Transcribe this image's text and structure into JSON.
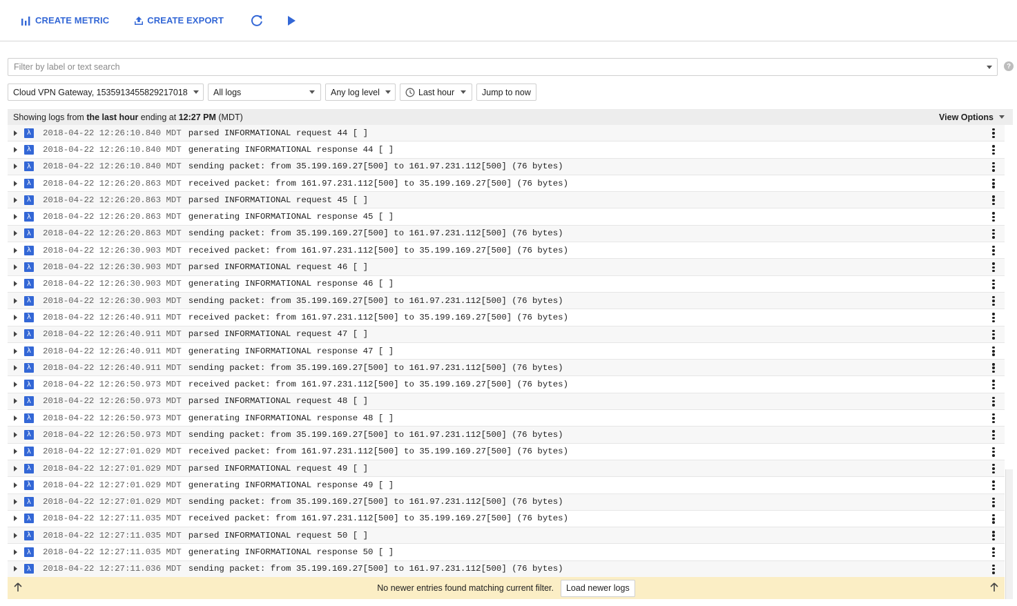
{
  "toolbar": {
    "create_metric": "CREATE METRIC",
    "create_export": "CREATE EXPORT"
  },
  "filter": {
    "placeholder": "Filter by label or text search",
    "help": "?"
  },
  "selectors": {
    "resource": "Cloud VPN Gateway, 1535913455829217018",
    "logs": "All logs",
    "level": "Any log level",
    "time": "Last hour",
    "jump": "Jump to now"
  },
  "header": {
    "prefix": "Showing logs from ",
    "range": "the last hour",
    "mid": " ending at ",
    "time": "12:27 PM",
    "tz": " (MDT)",
    "view_options": "View Options"
  },
  "severity_glyph": "λ",
  "logs": [
    {
      "ts": "2018-04-22 12:26:10.840 MDT",
      "msg": "parsed INFORMATIONAL request 44 [ ]"
    },
    {
      "ts": "2018-04-22 12:26:10.840 MDT",
      "msg": "generating INFORMATIONAL response 44 [ ]"
    },
    {
      "ts": "2018-04-22 12:26:10.840 MDT",
      "msg": "sending packet: from 35.199.169.27[500] to 161.97.231.112[500] (76 bytes)"
    },
    {
      "ts": "2018-04-22 12:26:20.863 MDT",
      "msg": "received packet: from 161.97.231.112[500] to 35.199.169.27[500] (76 bytes)"
    },
    {
      "ts": "2018-04-22 12:26:20.863 MDT",
      "msg": "parsed INFORMATIONAL request 45 [ ]"
    },
    {
      "ts": "2018-04-22 12:26:20.863 MDT",
      "msg": "generating INFORMATIONAL response 45 [ ]"
    },
    {
      "ts": "2018-04-22 12:26:20.863 MDT",
      "msg": "sending packet: from 35.199.169.27[500] to 161.97.231.112[500] (76 bytes)"
    },
    {
      "ts": "2018-04-22 12:26:30.903 MDT",
      "msg": "received packet: from 161.97.231.112[500] to 35.199.169.27[500] (76 bytes)"
    },
    {
      "ts": "2018-04-22 12:26:30.903 MDT",
      "msg": "parsed INFORMATIONAL request 46 [ ]"
    },
    {
      "ts": "2018-04-22 12:26:30.903 MDT",
      "msg": "generating INFORMATIONAL response 46 [ ]"
    },
    {
      "ts": "2018-04-22 12:26:30.903 MDT",
      "msg": "sending packet: from 35.199.169.27[500] to 161.97.231.112[500] (76 bytes)"
    },
    {
      "ts": "2018-04-22 12:26:40.911 MDT",
      "msg": "received packet: from 161.97.231.112[500] to 35.199.169.27[500] (76 bytes)"
    },
    {
      "ts": "2018-04-22 12:26:40.911 MDT",
      "msg": "parsed INFORMATIONAL request 47 [ ]"
    },
    {
      "ts": "2018-04-22 12:26:40.911 MDT",
      "msg": "generating INFORMATIONAL response 47 [ ]"
    },
    {
      "ts": "2018-04-22 12:26:40.911 MDT",
      "msg": "sending packet: from 35.199.169.27[500] to 161.97.231.112[500] (76 bytes)"
    },
    {
      "ts": "2018-04-22 12:26:50.973 MDT",
      "msg": "received packet: from 161.97.231.112[500] to 35.199.169.27[500] (76 bytes)"
    },
    {
      "ts": "2018-04-22 12:26:50.973 MDT",
      "msg": "parsed INFORMATIONAL request 48 [ ]"
    },
    {
      "ts": "2018-04-22 12:26:50.973 MDT",
      "msg": "generating INFORMATIONAL response 48 [ ]"
    },
    {
      "ts": "2018-04-22 12:26:50.973 MDT",
      "msg": "sending packet: from 35.199.169.27[500] to 161.97.231.112[500] (76 bytes)"
    },
    {
      "ts": "2018-04-22 12:27:01.029 MDT",
      "msg": "received packet: from 161.97.231.112[500] to 35.199.169.27[500] (76 bytes)"
    },
    {
      "ts": "2018-04-22 12:27:01.029 MDT",
      "msg": "parsed INFORMATIONAL request 49 [ ]"
    },
    {
      "ts": "2018-04-22 12:27:01.029 MDT",
      "msg": "generating INFORMATIONAL response 49 [ ]"
    },
    {
      "ts": "2018-04-22 12:27:01.029 MDT",
      "msg": "sending packet: from 35.199.169.27[500] to 161.97.231.112[500] (76 bytes)"
    },
    {
      "ts": "2018-04-22 12:27:11.035 MDT",
      "msg": "received packet: from 161.97.231.112[500] to 35.199.169.27[500] (76 bytes)"
    },
    {
      "ts": "2018-04-22 12:27:11.035 MDT",
      "msg": "parsed INFORMATIONAL request 50 [ ]"
    },
    {
      "ts": "2018-04-22 12:27:11.035 MDT",
      "msg": "generating INFORMATIONAL response 50 [ ]"
    },
    {
      "ts": "2018-04-22 12:27:11.036 MDT",
      "msg": "sending packet: from 35.199.169.27[500] to 161.97.231.112[500] (76 bytes)"
    }
  ],
  "footer": {
    "message": "No newer entries found matching current filter.",
    "load_newer": "Load newer logs"
  },
  "colors": {
    "accent": "#3367d6",
    "footer_bg": "#fbeec5",
    "header_bg": "#ededed"
  },
  "icons": {
    "create_metric": "bar-chart-icon",
    "create_export": "upload-icon",
    "refresh": "refresh-icon",
    "stream": "play-icon",
    "time": "clock-icon",
    "scroll_top": "arrow-up-icon"
  }
}
